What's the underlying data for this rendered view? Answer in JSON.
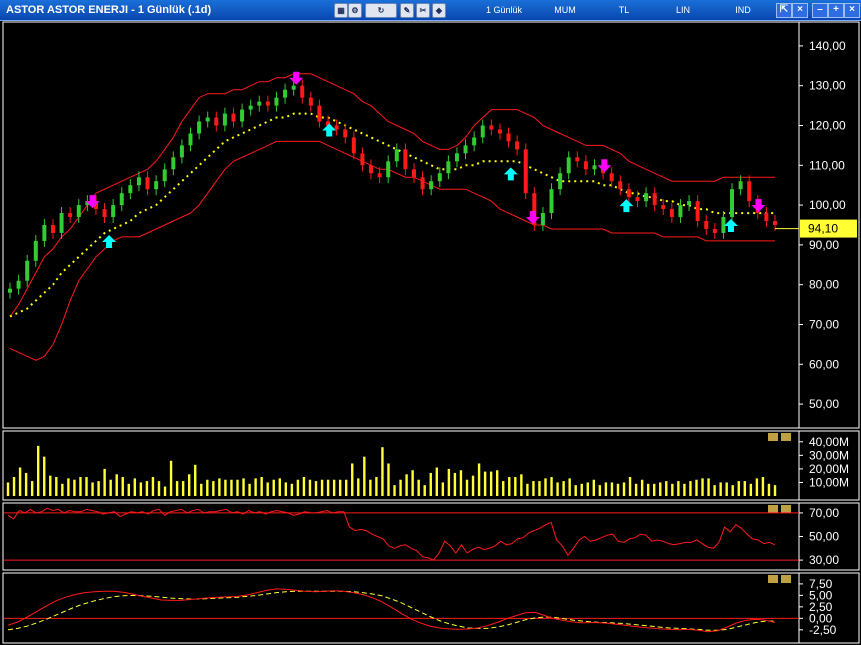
{
  "window": {
    "title": "ASTOR ASTOR ENERJI - 1 Günlük (.1d)",
    "toolbar": [
      "1 Günlük",
      "MUM",
      "TL",
      "LIN",
      "IND"
    ],
    "icons": [
      "chart-icon",
      "settings-icon",
      "refresh-icon",
      "draw-icon",
      "tools-icon",
      "zoom-icon"
    ]
  },
  "colors": {
    "background": "#000000",
    "candle_up": "#33cc33",
    "candle_down": "#ff1a1a",
    "bollinger": "#ff1a1a",
    "middle_line": "#ffff00",
    "volume": "#ffff33",
    "buy_arrow": "#00ffff",
    "sell_arrow": "#ff00ff",
    "price_tag": "#ffff33"
  },
  "chart_data": [
    {
      "type": "candlestick",
      "panel": "price",
      "title": "",
      "ylim": [
        45,
        145
      ],
      "yticks": [
        "50,00",
        "60,00",
        "70,00",
        "80,00",
        "90,00",
        "100,00",
        "110,00",
        "120,00",
        "130,00",
        "140,00"
      ],
      "last_price_label": "94,10",
      "last_price": 94.1,
      "close": [
        79,
        81,
        86,
        91,
        95,
        93,
        98,
        97,
        100,
        101,
        99,
        97,
        100,
        103,
        105,
        107,
        104,
        106,
        109,
        112,
        115,
        118,
        121,
        122,
        120,
        123,
        121,
        124,
        125,
        126,
        125,
        127,
        129,
        130,
        127,
        125,
        121,
        120,
        119,
        117,
        113,
        110,
        108,
        107,
        111,
        114,
        109,
        107,
        104,
        106,
        108,
        111,
        113,
        115,
        117,
        120,
        119,
        118,
        116,
        114,
        103,
        95,
        98,
        104,
        108,
        112,
        111,
        109,
        110,
        108,
        106,
        104,
        102,
        101,
        103,
        100,
        99,
        97,
        100,
        101,
        96,
        94,
        93,
        97,
        104,
        106,
        101,
        98,
        96,
        95
      ],
      "open": [
        78,
        79,
        81,
        86,
        91,
        95,
        93,
        98,
        97,
        100,
        101,
        99,
        97,
        100,
        103,
        105,
        107,
        104,
        106,
        109,
        112,
        115,
        118,
        121,
        122,
        120,
        123,
        121,
        124,
        125,
        126,
        125,
        127,
        129,
        130,
        127,
        125,
        121,
        120,
        119,
        117,
        113,
        110,
        108,
        107,
        111,
        114,
        109,
        107,
        104,
        106,
        108,
        111,
        113,
        115,
        117,
        120,
        119,
        118,
        116,
        114,
        103,
        95,
        98,
        104,
        108,
        112,
        111,
        109,
        110,
        108,
        106,
        104,
        102,
        101,
        103,
        100,
        99,
        97,
        100,
        101,
        96,
        94,
        93,
        97,
        104,
        106,
        101,
        98,
        96
      ],
      "bb_upper": [
        72,
        75,
        79,
        83,
        87,
        89,
        92,
        94,
        97,
        100,
        103,
        104,
        105,
        106,
        107,
        108,
        109,
        111,
        114,
        117,
        121,
        124,
        127,
        128,
        128,
        128,
        129,
        129,
        130,
        131,
        131,
        132,
        132,
        133,
        133,
        133,
        132,
        131,
        130,
        129,
        128,
        126,
        125,
        123,
        121,
        120,
        119,
        118,
        116,
        115,
        114,
        114,
        115,
        117,
        120,
        122,
        124,
        124,
        124,
        124,
        123,
        122,
        120,
        119,
        118,
        117,
        116,
        115,
        115,
        115,
        114,
        113,
        111,
        110,
        109,
        108,
        107,
        106,
        106,
        106,
        106,
        106,
        106,
        107,
        107,
        107,
        107,
        107,
        107,
        107
      ],
      "bb_middle": [
        72,
        73,
        74,
        76,
        78,
        80,
        83,
        85,
        87,
        89,
        91,
        93,
        94,
        95,
        96,
        98,
        99,
        100,
        102,
        104,
        106,
        108,
        110,
        112,
        114,
        116,
        117,
        118,
        119,
        120,
        121,
        122,
        122,
        123,
        123,
        123,
        122,
        122,
        121,
        120,
        119,
        118,
        117,
        116,
        115,
        114,
        113,
        112,
        111,
        110,
        109,
        109,
        109,
        110,
        110,
        111,
        111,
        111,
        111,
        111,
        110,
        109,
        108,
        107,
        106,
        106,
        106,
        106,
        106,
        105,
        105,
        104,
        103,
        103,
        102,
        102,
        101,
        101,
        100,
        100,
        99,
        99,
        98,
        98,
        98,
        98,
        98,
        98,
        98,
        98
      ],
      "bb_lower": [
        64,
        63,
        62,
        61,
        62,
        65,
        70,
        76,
        81,
        84,
        87,
        89,
        91,
        92,
        92,
        92,
        93,
        94,
        95,
        96,
        97,
        98,
        100,
        103,
        106,
        109,
        111,
        112,
        113,
        114,
        115,
        116,
        116,
        116,
        116,
        116,
        116,
        115,
        114,
        113,
        112,
        111,
        110,
        109,
        109,
        108,
        107,
        107,
        106,
        105,
        104,
        104,
        104,
        104,
        103,
        102,
        101,
        99,
        98,
        97,
        96,
        95,
        95,
        94,
        94,
        94,
        94,
        94,
        94,
        94,
        93,
        93,
        93,
        93,
        93,
        93,
        92,
        92,
        92,
        92,
        92,
        91,
        91,
        91,
        91,
        91,
        91,
        91,
        91,
        91
      ],
      "buy_signals": [
        18,
        58,
        91,
        112,
        131
      ],
      "sell_signals": [
        15,
        52,
        95,
        108,
        136
      ]
    },
    {
      "type": "bar",
      "panel": "volume",
      "ylim": [
        0,
        45
      ],
      "yticks": [
        "10,00M",
        "20,00M",
        "30,00M",
        "40,00M"
      ],
      "values": [
        10,
        14,
        21,
        17,
        11,
        37,
        29,
        15,
        14,
        9,
        13,
        12,
        14,
        14,
        10,
        11,
        20,
        12,
        16,
        14,
        9,
        13,
        10,
        11,
        14,
        11,
        7,
        26,
        11,
        11,
        16,
        23,
        9,
        12,
        11,
        13,
        12,
        12,
        12,
        13,
        9,
        13,
        14,
        10,
        12,
        13,
        10,
        9,
        12,
        14,
        12,
        11,
        12,
        12,
        12,
        12,
        12,
        24,
        13,
        29,
        12,
        14,
        36,
        24,
        8,
        12,
        16,
        19,
        12,
        8,
        17,
        21,
        10,
        20,
        17,
        19,
        12,
        15,
        24,
        18,
        18,
        19,
        11,
        14,
        14,
        16,
        9,
        11,
        11,
        13,
        14,
        10,
        11,
        13,
        8,
        9,
        10,
        12,
        8,
        10,
        10,
        9,
        10,
        14,
        9,
        12,
        9,
        9,
        10,
        11,
        9,
        11,
        9,
        11,
        12,
        13,
        13,
        8,
        10,
        10,
        8,
        11,
        11,
        9,
        13,
        14,
        9,
        8
      ]
    },
    {
      "type": "line",
      "panel": "rsi",
      "ylim": [
        25,
        75
      ],
      "yticks": [
        "30,00",
        "50,00",
        "70,00"
      ],
      "reference_lines": [
        70,
        30
      ],
      "values": [
        68,
        65,
        72,
        70,
        73,
        70,
        71,
        74,
        72,
        73,
        70,
        72,
        71,
        71,
        73,
        72,
        71,
        69,
        70,
        71,
        67,
        69,
        71,
        70,
        71,
        69,
        72,
        73,
        68,
        71,
        72,
        73,
        70,
        72,
        73,
        70,
        71,
        71,
        72,
        73,
        70,
        71,
        69,
        72,
        70,
        71,
        69,
        71,
        72,
        71,
        70,
        68,
        69,
        71,
        70,
        70,
        71,
        72,
        70,
        71,
        71,
        58,
        55,
        56,
        55,
        52,
        50,
        48,
        42,
        40,
        42,
        43,
        40,
        38,
        33,
        32,
        30,
        36,
        46,
        42,
        36,
        43,
        36,
        39,
        41,
        39,
        40,
        42,
        46,
        43,
        44,
        48,
        49,
        53,
        55,
        57,
        60,
        62,
        47,
        42,
        34,
        40,
        47,
        50,
        46,
        47,
        49,
        51,
        52,
        46,
        45,
        48,
        49,
        52,
        51,
        46,
        47,
        46,
        44,
        43,
        44,
        45,
        45,
        47,
        44,
        41,
        40,
        45,
        58,
        54,
        60,
        57,
        52,
        48,
        47,
        44,
        45,
        43
      ]
    },
    {
      "type": "line",
      "panel": "macd",
      "ylim": [
        -4.5,
        9
      ],
      "yticks": [
        "-2,50",
        "0,00",
        "2,50",
        "5,00",
        "7,50"
      ],
      "reference_lines": [
        0
      ],
      "macd": [
        -1.5,
        -0.8,
        0.3,
        1.5,
        2.7,
        3.8,
        4.6,
        5.2,
        5.6,
        5.8,
        5.9,
        5.9,
        5.7,
        5.3,
        4.8,
        4.4,
        4.0,
        3.9,
        3.9,
        4.1,
        4.3,
        4.5,
        4.6,
        4.7,
        4.8,
        5.1,
        5.6,
        6.1,
        6.4,
        6.3,
        6.1,
        5.9,
        5.8,
        5.9,
        6.0,
        5.9,
        5.6,
        5.2,
        4.5,
        3.6,
        2.4,
        1.1,
        -0.1,
        -1.0,
        -1.7,
        -2.1,
        -2.3,
        -2.4,
        -2.3,
        -2.1,
        -1.6,
        -0.9,
        -0.1,
        0.6,
        1.2,
        1.3,
        0.6,
        -0.1,
        -0.5,
        -0.8,
        -1.0,
        -0.9,
        -1.0,
        -1.2,
        -1.4,
        -1.7,
        -1.9,
        -2.1,
        -2.3,
        -2.4,
        -2.5,
        -2.4,
        -2.6,
        -2.9,
        -2.7,
        -1.9,
        -1.0,
        -0.4,
        -0.2,
        -0.4,
        -0.9
      ],
      "signal": [
        -2.5,
        -2.2,
        -1.7,
        -1.0,
        -0.2,
        0.7,
        1.6,
        2.5,
        3.2,
        3.8,
        4.3,
        4.7,
        4.9,
        5.0,
        4.9,
        4.8,
        4.6,
        4.4,
        4.3,
        4.2,
        4.2,
        4.3,
        4.4,
        4.5,
        4.6,
        4.8,
        5.0,
        5.3,
        5.6,
        5.8,
        5.9,
        5.9,
        5.9,
        5.9,
        5.9,
        5.9,
        5.8,
        5.6,
        5.3,
        4.9,
        4.2,
        3.4,
        2.4,
        1.4,
        0.4,
        -0.5,
        -1.2,
        -1.7,
        -2.1,
        -2.2,
        -2.2,
        -1.9,
        -1.5,
        -0.9,
        -0.3,
        0.1,
        0.3,
        0.2,
        -0.1,
        -0.4,
        -0.6,
        -0.8,
        -0.9,
        -1.0,
        -1.1,
        -1.3,
        -1.5,
        -1.7,
        -1.9,
        -2.1,
        -2.2,
        -2.3,
        -2.4,
        -2.6,
        -2.6,
        -2.4,
        -1.9,
        -1.4,
        -0.9,
        -0.6,
        -0.6
      ]
    }
  ]
}
